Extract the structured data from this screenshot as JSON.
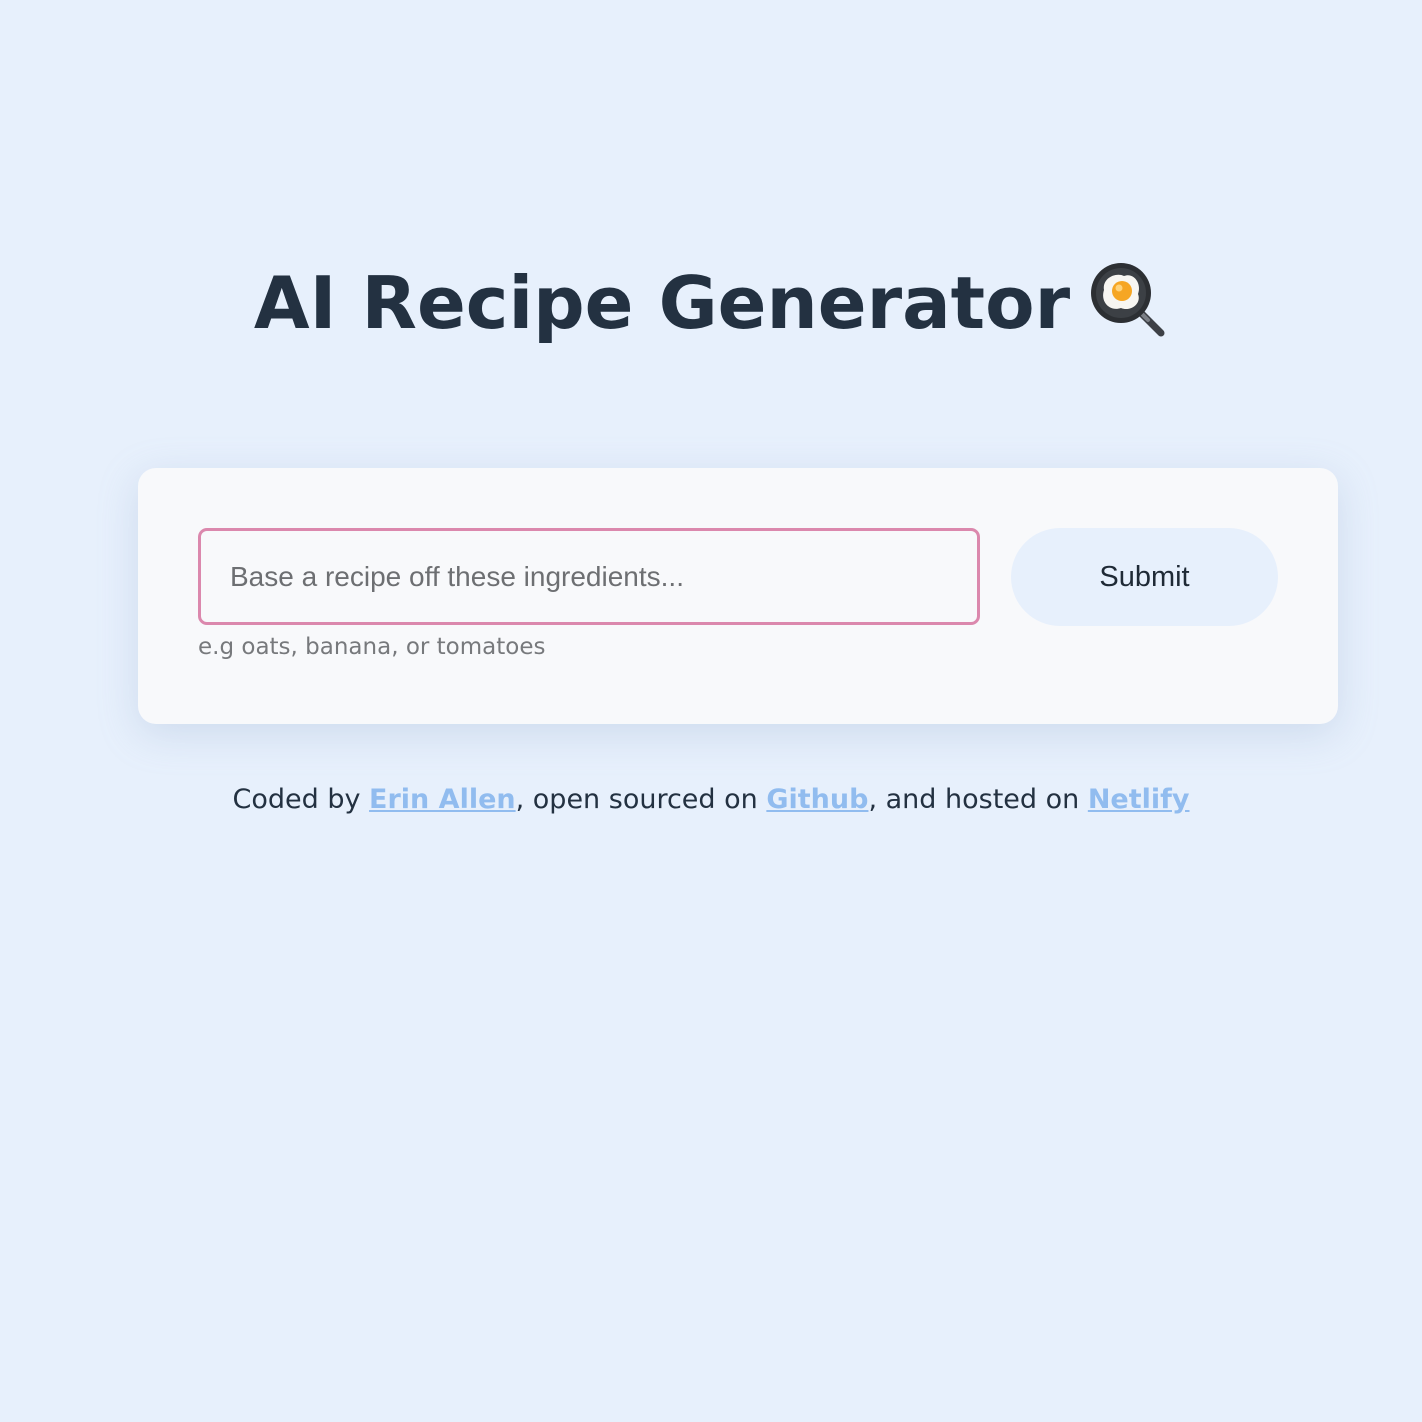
{
  "header": {
    "title": "AI Recipe Generator",
    "title_icon": "frying-pan-egg-icon"
  },
  "form": {
    "input_placeholder": "Base a recipe off these ingredients...",
    "input_value": "",
    "hint": "e.g oats, banana, or tomatoes",
    "submit_label": "Submit"
  },
  "footer": {
    "prefix": "Coded by ",
    "author_link": "Erin Allen",
    "middle1": ", open sourced on ",
    "github_link": "Github",
    "middle2": ", and hosted on ",
    "netlify_link": "Netlify"
  },
  "colors": {
    "background": "#e7f0fc",
    "card": "#f8f9fb",
    "title": "#233141",
    "input_border": "#db88ad",
    "link": "#91bcef",
    "button_bg": "#e7f0fc"
  }
}
